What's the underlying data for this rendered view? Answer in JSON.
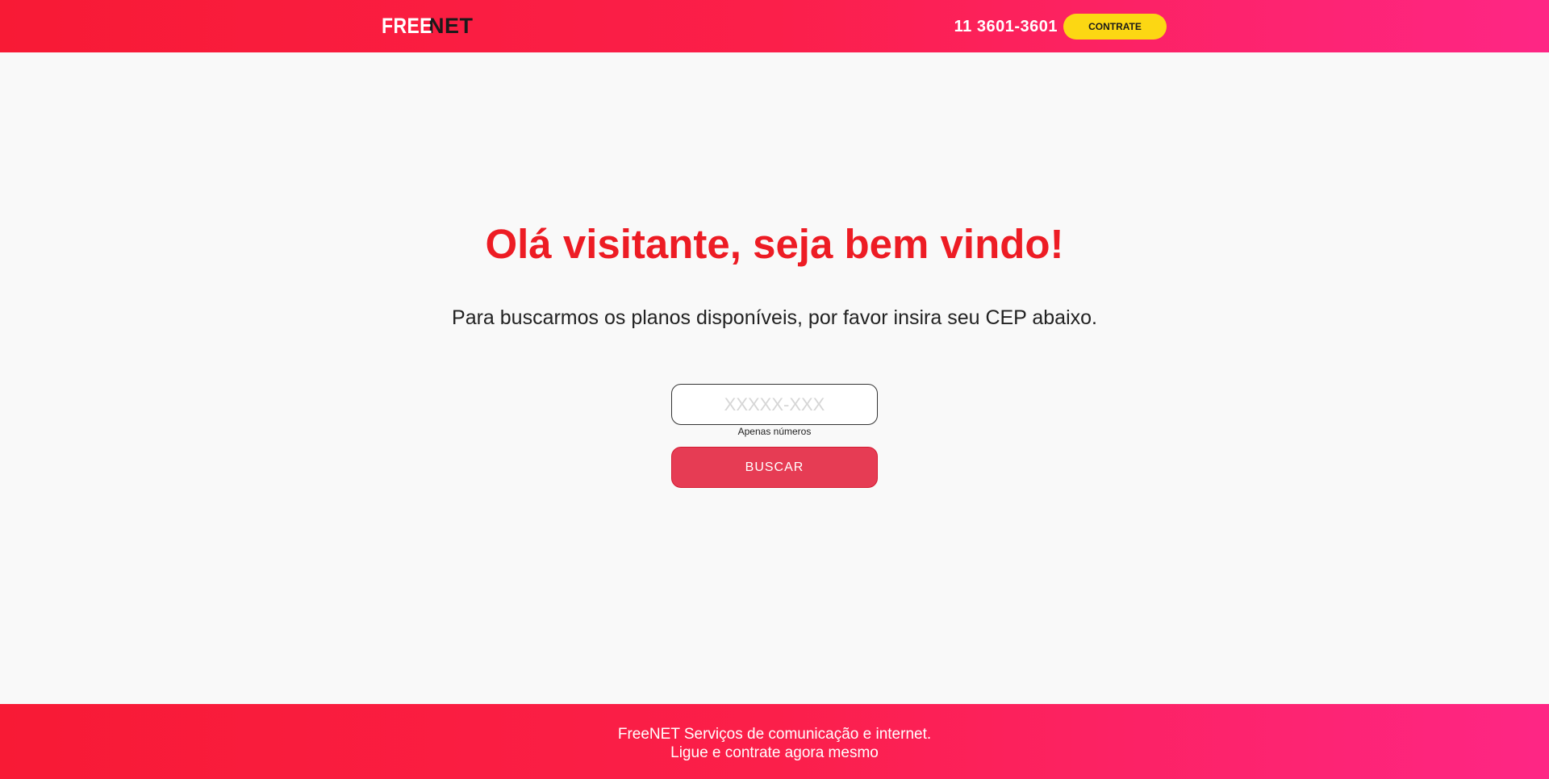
{
  "header": {
    "logo": {
      "part1": "FREE",
      "part2": "NET"
    },
    "phone": "11 3601-3601",
    "cta_label": "CONTRATE"
  },
  "main": {
    "title": "Olá visitante, seja bem vindo!",
    "subtitle": "Para buscarmos os planos disponíveis, por favor insira seu CEP abaixo.",
    "cep_input": {
      "value": "",
      "placeholder": "XXXXX-XXX"
    },
    "hint": "Apenas números",
    "search_label": "BUSCAR"
  },
  "footer": {
    "line1": "FreeNET Serviços de comunicação e internet.",
    "line2": "Ligue e contrate agora mesmo"
  },
  "colors": {
    "brand_red": "#ed1c24",
    "header_gradient_start": "#f81a35",
    "header_gradient_end": "#fe2685",
    "cta_yellow": "#fcd713",
    "button_red": "#e63c54",
    "background": "#f9f9f9"
  }
}
